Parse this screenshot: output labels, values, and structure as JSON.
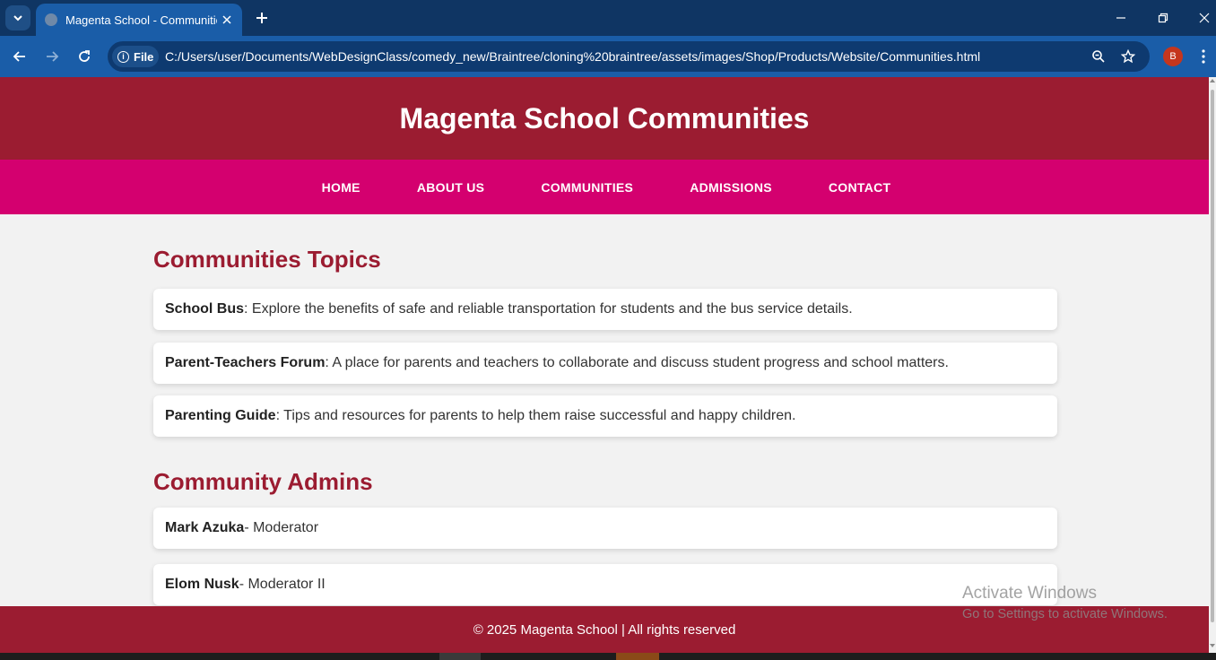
{
  "browser": {
    "tab_title": "Magenta School - Communities",
    "site_chip_label": "File",
    "url": "C:/Users/user/Documents/WebDesignClass/comedy_new/Braintree/cloning%20braintree/assets/images/Shop/Products/Website/Communities.html",
    "profile_initial": "B",
    "accent_color": "#1a5da8",
    "tabbar_color": "#0f3563"
  },
  "site": {
    "title": "Magenta School Communities",
    "header_color": "#9b1c31",
    "nav_color": "#d4006f",
    "nav_items": [
      {
        "label": "HOME"
      },
      {
        "label": "ABOUT US"
      },
      {
        "label": "COMMUNITIES"
      },
      {
        "label": "ADMISSIONS"
      },
      {
        "label": "CONTACT"
      }
    ]
  },
  "topics": {
    "heading": "Communities Topics",
    "items": [
      {
        "name": "School Bus",
        "description": ": Explore the benefits of safe and reliable transportation for students and the bus service details."
      },
      {
        "name": "Parent-Teachers Forum",
        "description": ": A place for parents and teachers to collaborate and discuss student progress and school matters."
      },
      {
        "name": "Parenting Guide",
        "description": ": Tips and resources for parents to help them raise successful and happy children."
      }
    ]
  },
  "admins": {
    "heading": "Community Admins",
    "items": [
      {
        "name": "Mark Azuka",
        "role": " - Moderator"
      },
      {
        "name": "Elom Nusk",
        "role": " - Moderator II"
      }
    ]
  },
  "footer": {
    "text": "© 2025 Magenta School | All rights reserved"
  },
  "watermark": {
    "line1": "Activate Windows",
    "line2": "Go to Settings to activate Windows."
  }
}
